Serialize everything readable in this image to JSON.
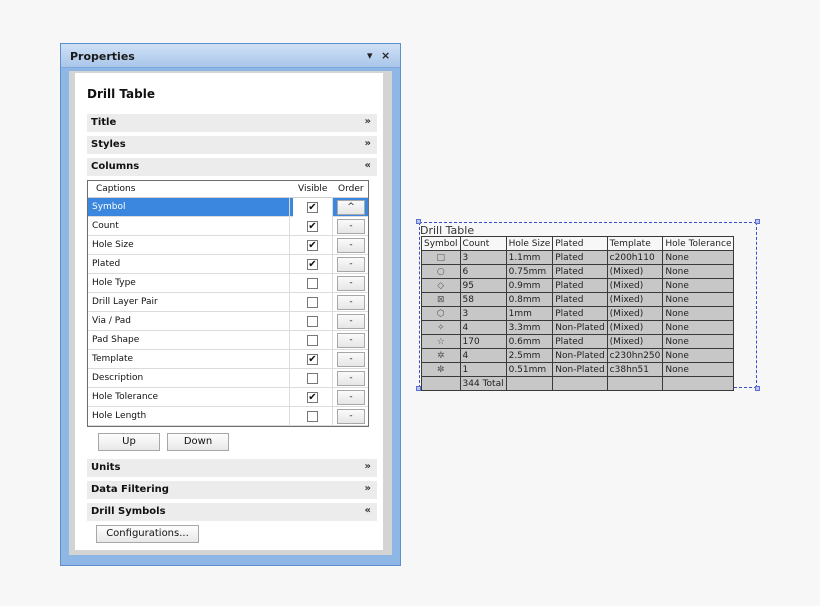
{
  "panel": {
    "title": "Properties",
    "pin_icon": "▾",
    "close_icon": "×",
    "content_title": "Drill Table"
  },
  "sections": {
    "title": "Title",
    "styles": "Styles",
    "columns": "Columns",
    "units": "Units",
    "data_filtering": "Data Filtering",
    "drill_symbols": "Drill Symbols"
  },
  "chevrons": {
    "collapsed": "»",
    "expanded": "«"
  },
  "columns_grid": {
    "headers": {
      "captions": "Captions",
      "visible": "Visible",
      "order": "Order"
    },
    "check_mark": "✔",
    "rows": [
      {
        "caption": "Symbol",
        "visible": true,
        "order": "^",
        "selected": true
      },
      {
        "caption": "Count",
        "visible": true,
        "order": "-"
      },
      {
        "caption": "Hole Size",
        "visible": true,
        "order": "-"
      },
      {
        "caption": "Plated",
        "visible": true,
        "order": "-"
      },
      {
        "caption": "Hole Type",
        "visible": false,
        "order": "-"
      },
      {
        "caption": "Drill Layer Pair",
        "visible": false,
        "order": "-"
      },
      {
        "caption": "Via / Pad",
        "visible": false,
        "order": "-"
      },
      {
        "caption": "Pad Shape",
        "visible": false,
        "order": "-"
      },
      {
        "caption": "Template",
        "visible": true,
        "order": "-"
      },
      {
        "caption": "Description",
        "visible": false,
        "order": "-"
      },
      {
        "caption": "Hole Tolerance",
        "visible": true,
        "order": "-"
      },
      {
        "caption": "Hole Length",
        "visible": false,
        "order": "-"
      }
    ]
  },
  "buttons": {
    "up": "Up",
    "down": "Down",
    "configurations": "Configurations..."
  },
  "drill_table": {
    "title": "Drill Table",
    "headers": [
      "Symbol",
      "Count",
      "Hole Size",
      "Plated",
      "Template",
      "Hole Tolerance"
    ],
    "rows": [
      {
        "symbol": "□",
        "count": "3",
        "hole_size": "1.1mm",
        "plated": "Plated",
        "template": "c200h110",
        "tolerance": "None"
      },
      {
        "symbol": "○",
        "count": "6",
        "hole_size": "0.75mm",
        "plated": "Plated",
        "template": "(Mixed)",
        "tolerance": "None"
      },
      {
        "symbol": "◇",
        "count": "95",
        "hole_size": "0.9mm",
        "plated": "Plated",
        "template": "(Mixed)",
        "tolerance": "None"
      },
      {
        "symbol": "⊠",
        "count": "58",
        "hole_size": "0.8mm",
        "plated": "Plated",
        "template": "(Mixed)",
        "tolerance": "None"
      },
      {
        "symbol": "⬡",
        "count": "3",
        "hole_size": "1mm",
        "plated": "Plated",
        "template": "(Mixed)",
        "tolerance": "None"
      },
      {
        "symbol": "✧",
        "count": "4",
        "hole_size": "3.3mm",
        "plated": "Non-Plated",
        "template": "(Mixed)",
        "tolerance": "None"
      },
      {
        "symbol": "☆",
        "count": "170",
        "hole_size": "0.6mm",
        "plated": "Plated",
        "template": "(Mixed)",
        "tolerance": "None"
      },
      {
        "symbol": "✲",
        "count": "4",
        "hole_size": "2.5mm",
        "plated": "Non-Plated",
        "template": "c230hn250",
        "tolerance": "None"
      },
      {
        "symbol": "✼",
        "count": "1",
        "hole_size": "0.51mm",
        "plated": "Non-Plated",
        "template": "c38hn51",
        "tolerance": "None"
      }
    ],
    "total": "344 Total"
  },
  "colors": {
    "panel_frame": "#8fb7e6",
    "selection": "#3b87e0",
    "drill_border": "#3a4fd0"
  }
}
